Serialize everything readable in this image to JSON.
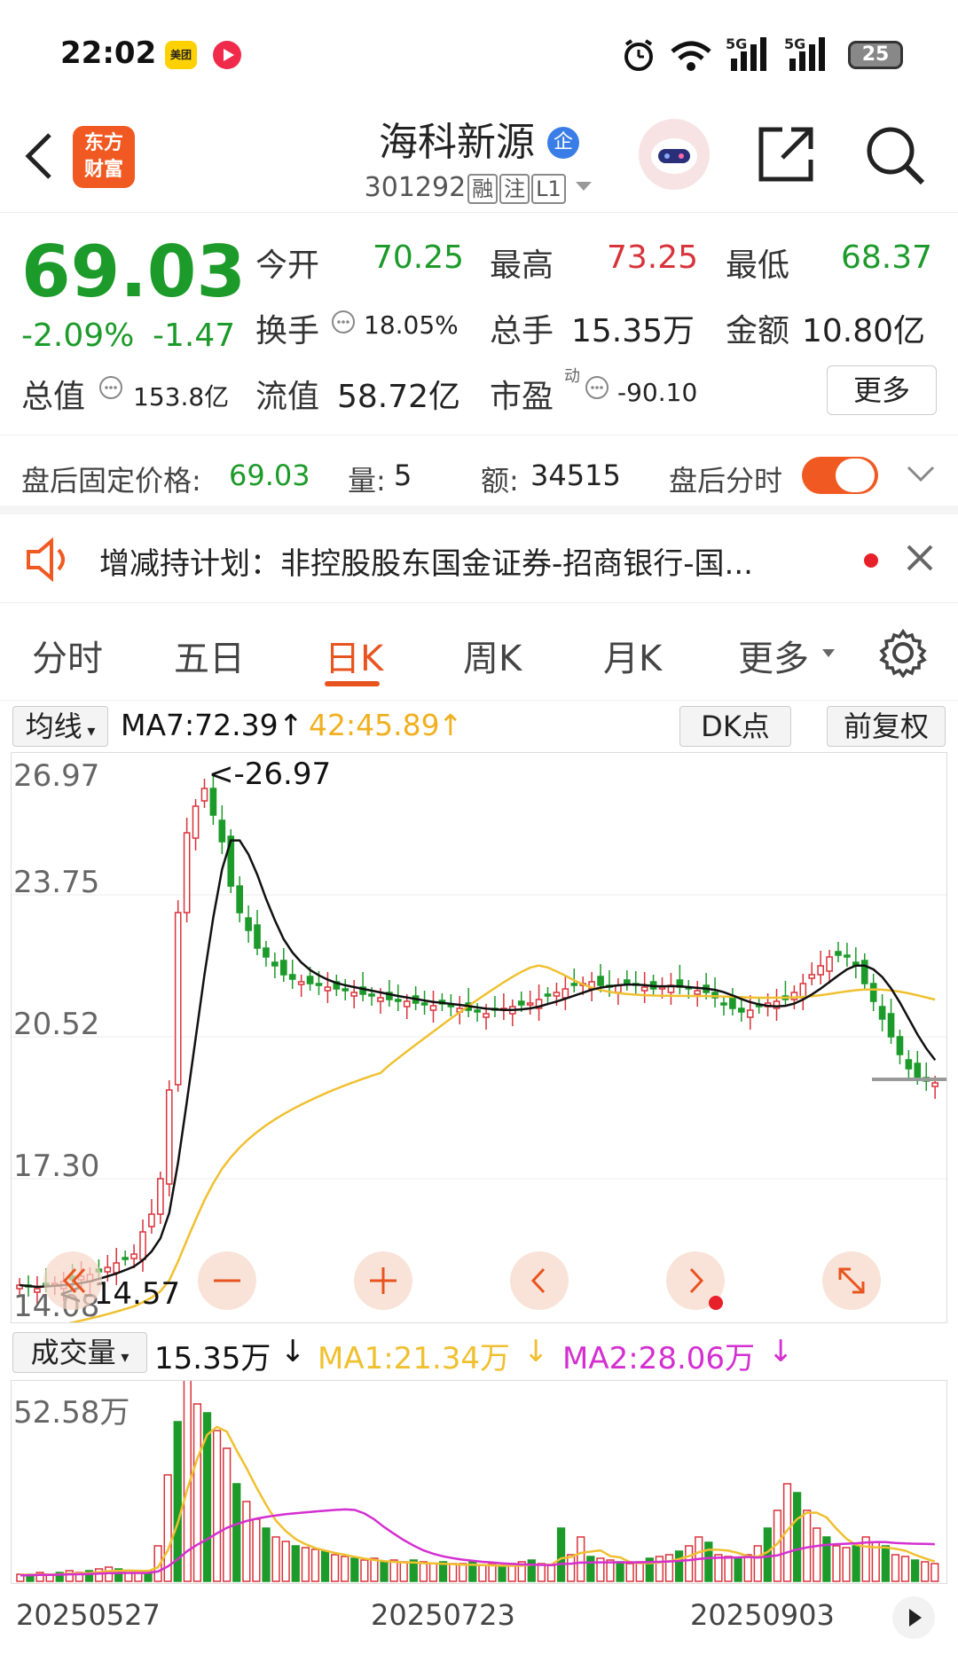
{
  "status_bar": {
    "time": "22:02",
    "app1": "美团",
    "battery": "25",
    "network1": "5G",
    "network2": "5G"
  },
  "header": {
    "logo_line1": "东方",
    "logo_line2": "财富",
    "stock_name": "海科新源",
    "company_badge": "企",
    "stock_code": "301292",
    "tag1": "融",
    "tag2": "注",
    "tag3": "L1"
  },
  "quote": {
    "price": "69.03",
    "change_pct": "-2.09%",
    "change": "-1.47",
    "open_label": "今开",
    "open": "70.25",
    "high_label": "最高",
    "high": "73.25",
    "low_label": "最低",
    "low": "68.37",
    "turnover_label": "换手",
    "turnover": "18.05%",
    "volume_label": "总手",
    "volume": "15.35万",
    "amount_label": "金额",
    "amount": "10.80亿",
    "mktcap_label": "总值",
    "mktcap": "153.8亿",
    "float_label": "流值",
    "float": "58.72亿",
    "pe_label": "市盈",
    "pe_sup": "动",
    "pe": "-90.10",
    "more_label": "更多"
  },
  "after_hours": {
    "price_label": "盘后固定价格:",
    "price": "69.03",
    "vol_label": "量:",
    "vol": "5",
    "amt_label": "额:",
    "amt": "34515",
    "toggle_label": "盘后分时"
  },
  "notice": {
    "text": "增减持计划：非控股股东国金证券-招商银行-国..."
  },
  "tabs": [
    "分时",
    "五日",
    "日K",
    "周K",
    "月K",
    "更多"
  ],
  "indicator": {
    "ma_select": "均线",
    "ma7": "MA7:72.39",
    "ma42": "42:45.89",
    "dk_label": "DK点",
    "adjust_label": "前复权"
  },
  "kline": {
    "y_labels": [
      "26.97",
      "23.75",
      "20.52",
      "17.30",
      "14.08"
    ],
    "high_marker": "<-26.97",
    "low_marker": "<-14.57"
  },
  "volume": {
    "select": "成交量",
    "value": "15.35万",
    "ma1": "MA1:21.34万",
    "ma2": "MA2:28.06万",
    "y_top": "52.58万"
  },
  "dates": [
    "20250527",
    "20250723",
    "20250903"
  ],
  "colors": {
    "up": "#d8333a",
    "down": "#1c9a2a",
    "accent": "#e8541f",
    "ma_black": "#111111",
    "ma_yellow": "#f0c030",
    "ma_magenta": "#d42fd0"
  }
}
